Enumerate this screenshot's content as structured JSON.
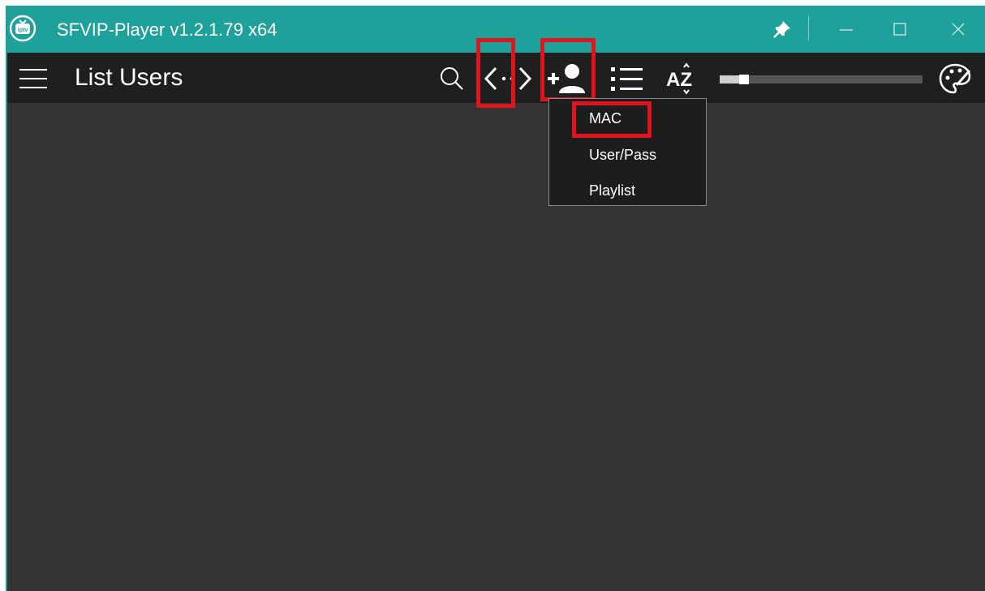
{
  "window": {
    "title": "SFVIP-Player v1.2.1.79 x64"
  },
  "title_bar": {
    "logo_text": "iptv",
    "controls": [
      "pin-icon",
      "minimize-icon",
      "maximize-icon",
      "close-icon"
    ]
  },
  "toolbar": {
    "page_title": "List Users",
    "icons": [
      "hamburger-menu-icon",
      "search-icon",
      "code-icon",
      "add-user-icon",
      "list-icon",
      "sort-az-icon",
      "palette-icon"
    ],
    "sort_label": "AZ",
    "slider_value": 0.12
  },
  "add_user_menu": {
    "items": [
      "MAC",
      "User/Pass",
      "Playlist"
    ]
  },
  "colors": {
    "titlebar": "#1fa19b",
    "toolbar": "#1f1f1f",
    "content": "#333333",
    "highlight": "#e0141c",
    "menu_bg": "#1d1d1d"
  }
}
